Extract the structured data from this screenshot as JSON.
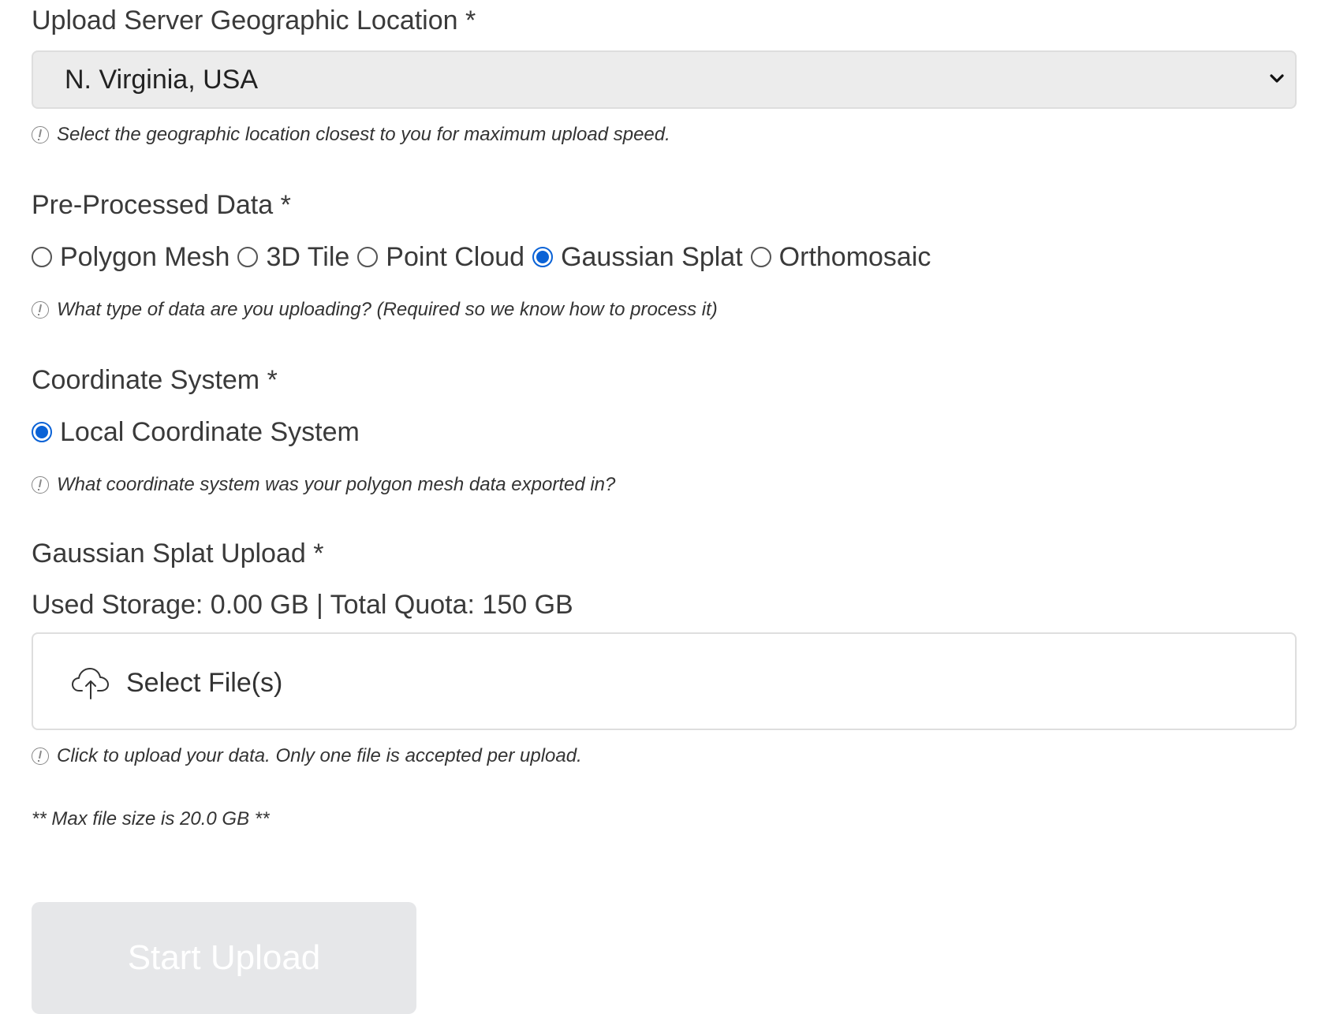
{
  "location": {
    "label": "Upload Server Geographic Location *",
    "selected": "N. Virginia, USA",
    "hint": "Select the geographic location closest to you for maximum upload speed."
  },
  "data_type": {
    "label": "Pre-Processed Data *",
    "options": [
      "Polygon Mesh",
      "3D Tile",
      "Point Cloud",
      "Gaussian Splat",
      "Orthomosaic"
    ],
    "selected": "Gaussian Splat",
    "hint": "What type of data are you uploading? (Required so we know how to process it)"
  },
  "coordinate_system": {
    "label": "Coordinate System *",
    "options": [
      "Local Coordinate System"
    ],
    "selected": "Local Coordinate System",
    "hint": "What coordinate system was your polygon mesh data exported in?"
  },
  "upload": {
    "label": "Gaussian Splat Upload *",
    "storage": "Used Storage: 0.00 GB | Total Quota: 150 GB",
    "select_label": "Select File(s)",
    "hint": "Click to upload your data. Only one file is accepted per upload.",
    "max_size_note": "** Max file size is 20.0 GB **"
  },
  "start_button": {
    "label": "Start Upload",
    "enabled": false
  },
  "colors": {
    "accent": "#0a62d6",
    "disabled_button": "#e6e7e9"
  }
}
